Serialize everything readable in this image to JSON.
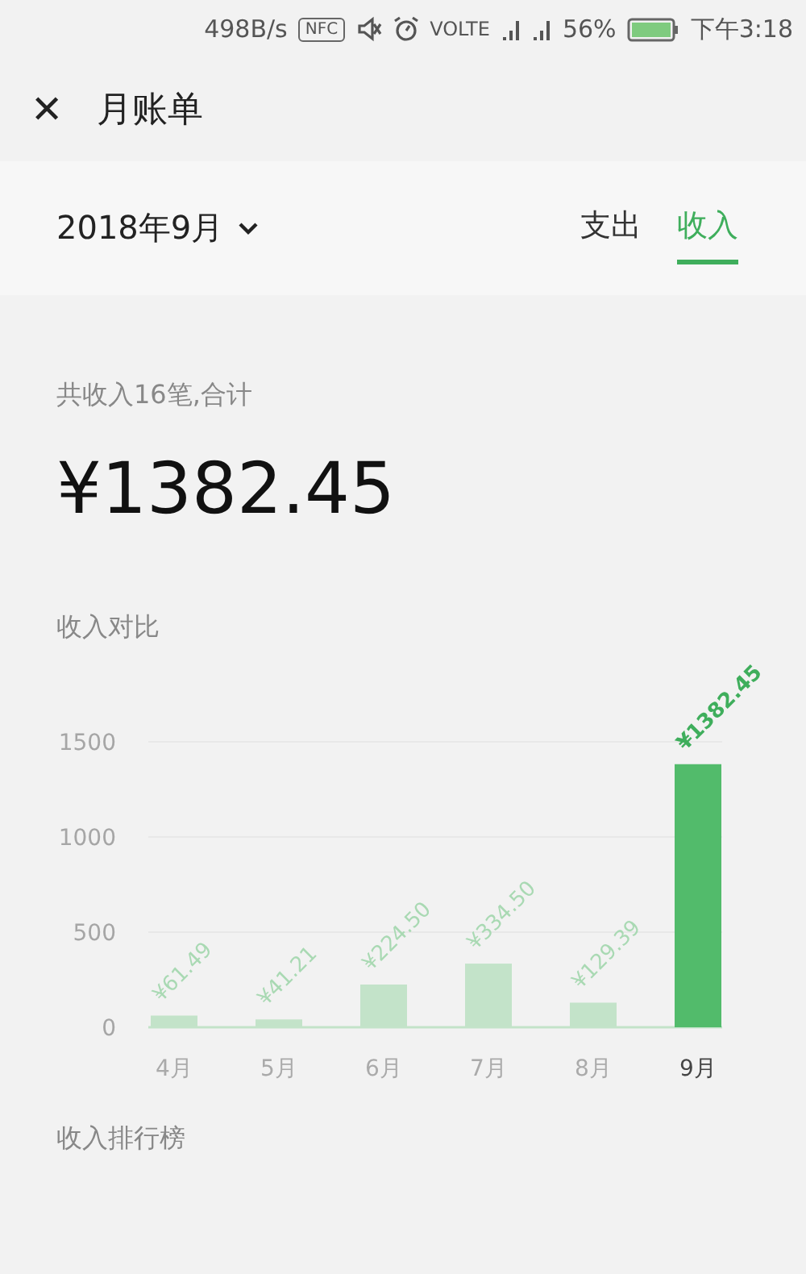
{
  "status_bar": {
    "speed": "498B/s",
    "nfc": "NFC",
    "volte": "VOLTE",
    "battery": "56%",
    "time": "下午3:18"
  },
  "header": {
    "close": "✕",
    "title": "月账单"
  },
  "period": {
    "month": "2018年9月",
    "tabs": [
      {
        "label": "支出",
        "selected": false
      },
      {
        "label": "收入",
        "selected": true
      }
    ]
  },
  "summary": {
    "caption": "共收入16笔,合计",
    "total": "¥1382.45"
  },
  "comparison": {
    "title": "收入对比",
    "chart_data": {
      "type": "bar",
      "categories": [
        "4月",
        "5月",
        "6月",
        "7月",
        "8月",
        "9月"
      ],
      "series": [
        {
          "values": [
            61.49,
            41.21,
            224.5,
            334.5,
            129.39,
            1382.45
          ]
        }
      ],
      "ylim": [
        0,
        1500
      ],
      "yticks": [
        0,
        500,
        1000,
        1500
      ],
      "value_labels": [
        "¥61.49",
        "¥41.21",
        "¥224.50",
        "¥334.50",
        "¥129.39",
        "¥1382.45"
      ]
    },
    "bars": [
      {
        "selected": false,
        "color": "#c3e3c9"
      },
      {
        "selected": false,
        "color": "#c3e3c9"
      },
      {
        "selected": false,
        "color": "#c3e3c9"
      },
      {
        "selected": false,
        "color": "#c3e3c9"
      },
      {
        "selected": false,
        "color": "#c3e3c9"
      },
      {
        "selected": true,
        "color": "#52bb6b"
      }
    ]
  },
  "ranking": {
    "title": "收入排行榜"
  }
}
